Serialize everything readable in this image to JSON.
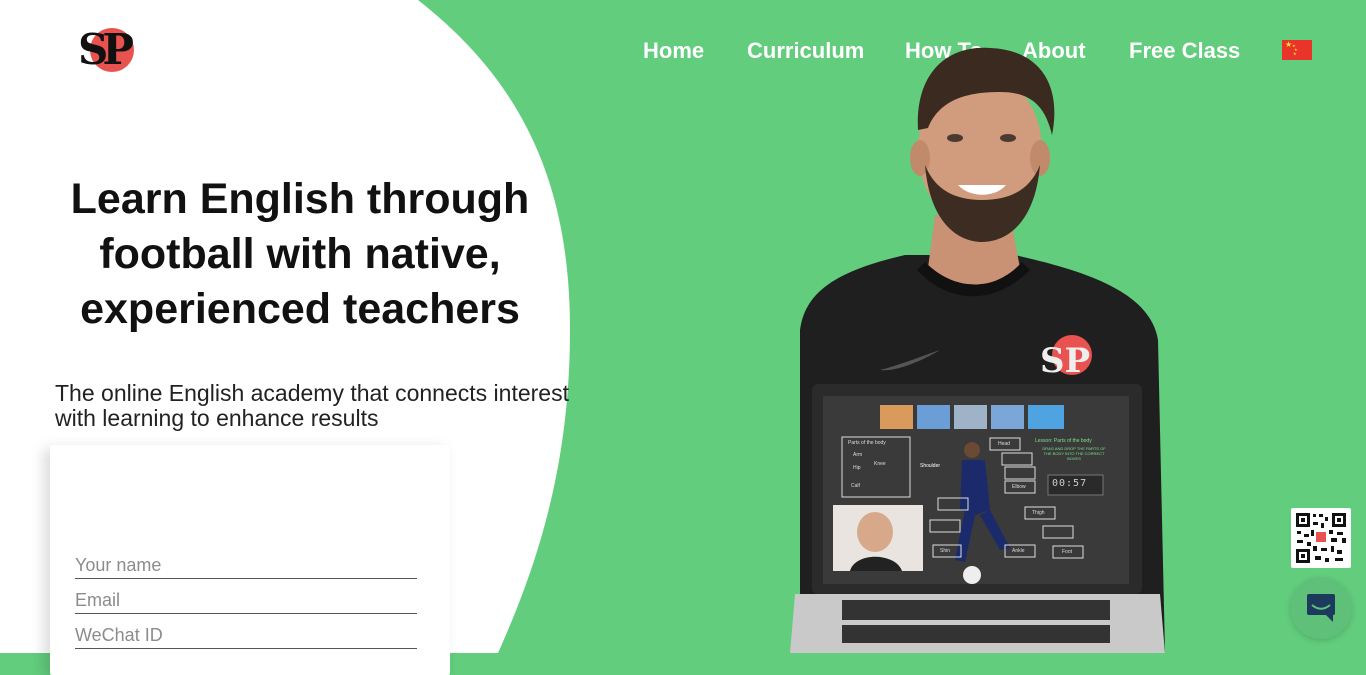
{
  "brand": {
    "logo_text": "SP"
  },
  "nav": {
    "items": [
      {
        "label": "Home"
      },
      {
        "label": "Curriculum"
      },
      {
        "label": "How To"
      },
      {
        "label": "About"
      },
      {
        "label": "Free Class"
      }
    ],
    "language_icon": "china-flag-icon"
  },
  "hero": {
    "title": "Learn English through football with native, experienced teachers",
    "subtitle": "The online English academy that connects interest with learning to enhance results"
  },
  "form": {
    "name_placeholder": "Your name",
    "email_placeholder": "Email",
    "wechat_placeholder": "WeChat ID"
  },
  "screen": {
    "timer": "00:57",
    "word_shoulder": "Shoulder",
    "word_knee": "Knee",
    "word_arm": "Arm",
    "word_hip": "Hip",
    "word_head": "Head",
    "word_elbow": "Elbow",
    "word_thigh": "Thigh",
    "word_shin": "Shin",
    "word_ankle": "Ankle",
    "word_foot": "Foot",
    "word_calf": "Calf",
    "panel_title": "Parts of the body",
    "lesson_title": "Lesson: Parts of the body",
    "instructions": "DRAG AND DROP THE PARTS OF THE BODY INTO THE CORRECT BOXES"
  },
  "widgets": {
    "qr_icon": "qr-code-icon",
    "chat_icon": "chat-bubble-icon"
  },
  "colors": {
    "green": "#62cd7d",
    "flag_red": "#e8342b",
    "logo_red": "#e8524f"
  }
}
